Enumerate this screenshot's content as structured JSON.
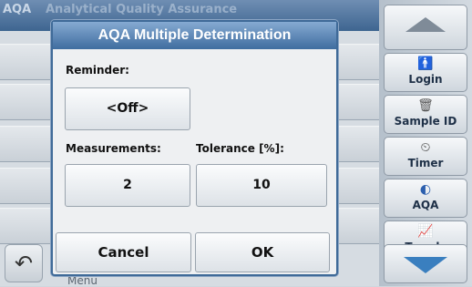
{
  "background": {
    "app_abbrev": "AQA",
    "screen_title": "Analytical Quality Assurance",
    "undo_icon": "↶",
    "menu_label": "Menu"
  },
  "sidebar": {
    "items": [
      {
        "label": "Login",
        "icon": "person-icon",
        "glyph": "🚹"
      },
      {
        "label": "Sample ID",
        "icon": "sample-id-icon",
        "glyph": "🗑"
      },
      {
        "label": "Timer",
        "icon": "timer-icon",
        "glyph": "⏲"
      },
      {
        "label": "AQA",
        "icon": "aqa-icon",
        "glyph": "◐"
      },
      {
        "label": "Trends",
        "icon": "trends-icon",
        "glyph": "📈"
      }
    ]
  },
  "dialog": {
    "title": "AQA Multiple Determination",
    "reminder_label": "Reminder:",
    "reminder_value": "<Off>",
    "measurements_label": "Measurements:",
    "measurements_value": "2",
    "tolerance_label": "Tolerance [%]:",
    "tolerance_value": "10",
    "cancel_label": "Cancel",
    "ok_label": "OK"
  }
}
